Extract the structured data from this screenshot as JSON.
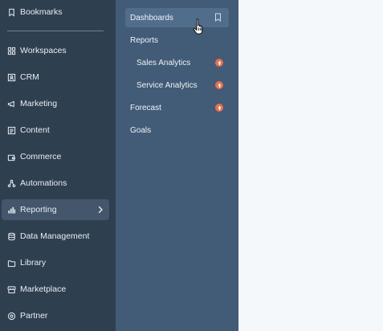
{
  "sidebar": {
    "top_item": {
      "label": "Bookmarks",
      "icon": "bookmark-icon"
    },
    "items": [
      {
        "label": "Workspaces",
        "icon": "grid-icon"
      },
      {
        "label": "CRM",
        "icon": "contacts-icon"
      },
      {
        "label": "Marketing",
        "icon": "megaphone-icon"
      },
      {
        "label": "Content",
        "icon": "content-icon"
      },
      {
        "label": "Commerce",
        "icon": "wallet-icon"
      },
      {
        "label": "Automations",
        "icon": "network-icon"
      },
      {
        "label": "Reporting",
        "icon": "chart-icon",
        "active": true
      },
      {
        "label": "Data Management",
        "icon": "database-icon"
      },
      {
        "label": "Library",
        "icon": "folder-icon"
      },
      {
        "label": "Marketplace",
        "icon": "store-icon"
      },
      {
        "label": "Partner",
        "icon": "partner-icon"
      }
    ]
  },
  "flyout": {
    "items": [
      {
        "label": "Dashboards",
        "hover": true,
        "bookmark": true
      },
      {
        "label": "Reports"
      },
      {
        "label": "Sales Analytics",
        "sub": true,
        "badge": true
      },
      {
        "label": "Service Analytics",
        "sub": true,
        "badge": true
      },
      {
        "label": "Forecast",
        "badge": true
      },
      {
        "label": "Goals"
      }
    ]
  },
  "colors": {
    "sidebar_bg": "#2e3f50",
    "flyout_bg": "#425b76",
    "active_bg": "#43566b",
    "badge": "#e86f4e",
    "content_bg": "#f5f8fa"
  }
}
